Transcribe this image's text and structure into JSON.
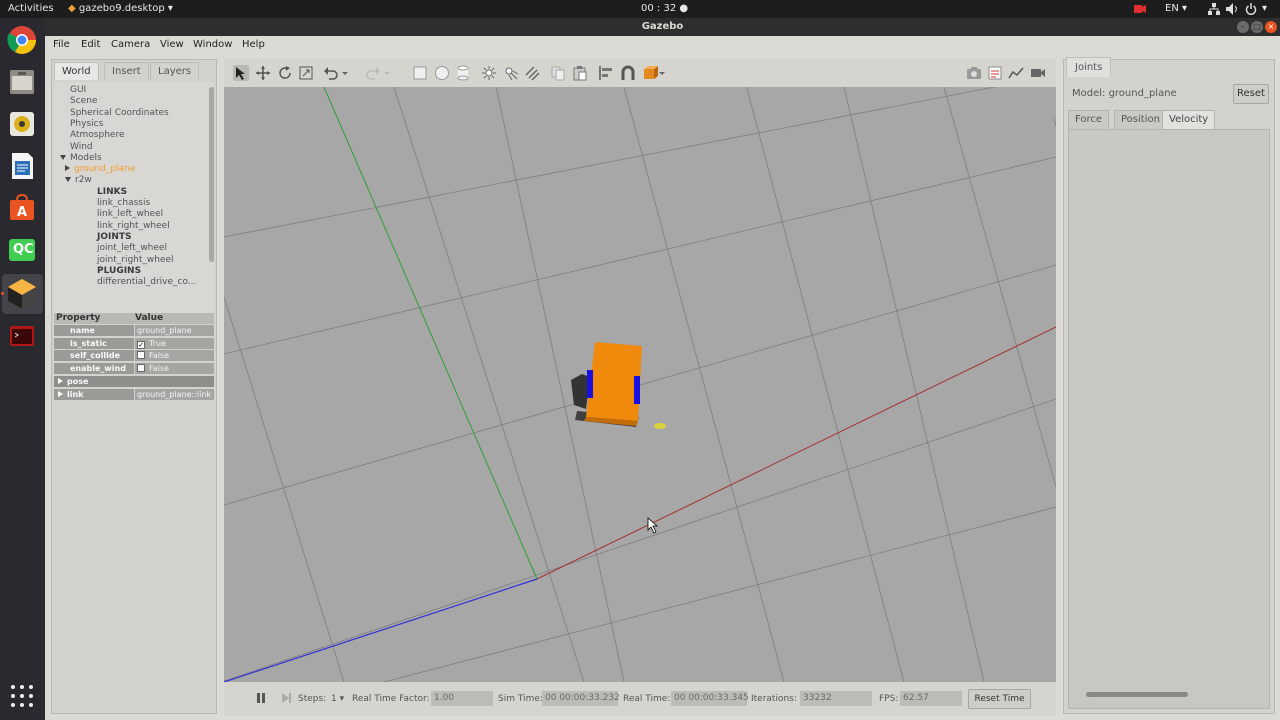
{
  "topbar": {
    "activities": "Activities",
    "app_menu": "gazebo9.desktop ▾",
    "clock": "00 : 32 ●",
    "lang": "EN ▾"
  },
  "dock": {
    "apps": [
      "chrome-icon",
      "files-icon",
      "rhythmbox-icon",
      "libreoffice-writer-icon",
      "software-center-icon",
      "qtcreator-icon",
      "gazebo-icon",
      "terminal-icon"
    ],
    "qc_label": "QC"
  },
  "window": {
    "title": "Gazebo",
    "menu": [
      "File",
      "Edit",
      "Camera",
      "View",
      "Window",
      "Help"
    ]
  },
  "left_panel": {
    "tabs": [
      "World",
      "Insert",
      "Layers"
    ],
    "tree": [
      {
        "label": "GUI",
        "indent": 0
      },
      {
        "label": "Scene",
        "indent": 0
      },
      {
        "label": "Spherical Coordinates",
        "indent": 0
      },
      {
        "label": "Physics",
        "indent": 0
      },
      {
        "label": "Atmosphere",
        "indent": 0
      },
      {
        "label": "Wind",
        "indent": 0
      },
      {
        "label": "Models",
        "indent": 0,
        "expander": "down"
      },
      {
        "label": "ground_plane",
        "indent": 1,
        "expander": "right",
        "style": "orange"
      },
      {
        "label": "r2w",
        "indent": 1,
        "expander": "down"
      },
      {
        "label": "LINKS",
        "indent": 2,
        "style": "bold"
      },
      {
        "label": "link_chassis",
        "indent": 2
      },
      {
        "label": "link_left_wheel",
        "indent": 2
      },
      {
        "label": "link_right_wheel",
        "indent": 2
      },
      {
        "label": "JOINTS",
        "indent": 2,
        "style": "bold"
      },
      {
        "label": "joint_left_wheel",
        "indent": 2
      },
      {
        "label": "joint_right_wheel",
        "indent": 2
      },
      {
        "label": "PLUGINS",
        "indent": 2,
        "style": "bold"
      },
      {
        "label": "differential_drive_co...",
        "indent": 2
      }
    ],
    "props_header": {
      "property": "Property",
      "value": "Value"
    },
    "props": [
      {
        "key": "name",
        "value": "ground_plane"
      },
      {
        "key": "is_static",
        "value": "True",
        "checkbox": true,
        "checked": true
      },
      {
        "key": "self_collide",
        "value": "False",
        "checkbox": true,
        "checked": false
      },
      {
        "key": "enable_wind",
        "value": "False",
        "checkbox": true,
        "checked": false
      },
      {
        "key": "pose",
        "expander": true
      },
      {
        "key": "link",
        "value": "ground_plane::link",
        "expander": true
      }
    ]
  },
  "bottom_bar": {
    "steps_label": "Steps:",
    "steps_value": "1 ▾",
    "rtf_label": "Real Time Factor:",
    "rtf_value": "1.00",
    "sim_time_label": "Sim Time:",
    "sim_time_value": "00 00:00:33.232",
    "real_time_label": "Real Time:",
    "real_time_value": "00 00:00:33.345",
    "iterations_label": "Iterations:",
    "iterations_value": "33232",
    "fps_label": "FPS:",
    "fps_value": "62.57",
    "reset_time": "Reset Time"
  },
  "right_panel": {
    "tab": "Joints",
    "model_label": "Model: ground_plane",
    "reset": "Reset",
    "tabs": [
      "Force",
      "Position",
      "Velocity"
    ],
    "active_tab": "Velocity"
  },
  "colors": {
    "robot_chassis": "#f08a0c",
    "robot_wheel": "#1a10e0",
    "grid_line": "#7e7e7e",
    "x_axis": "#b02020",
    "y_axis": "#20a020",
    "z_axis": "#2020d0",
    "ubuntu_orange": "#e95420"
  }
}
